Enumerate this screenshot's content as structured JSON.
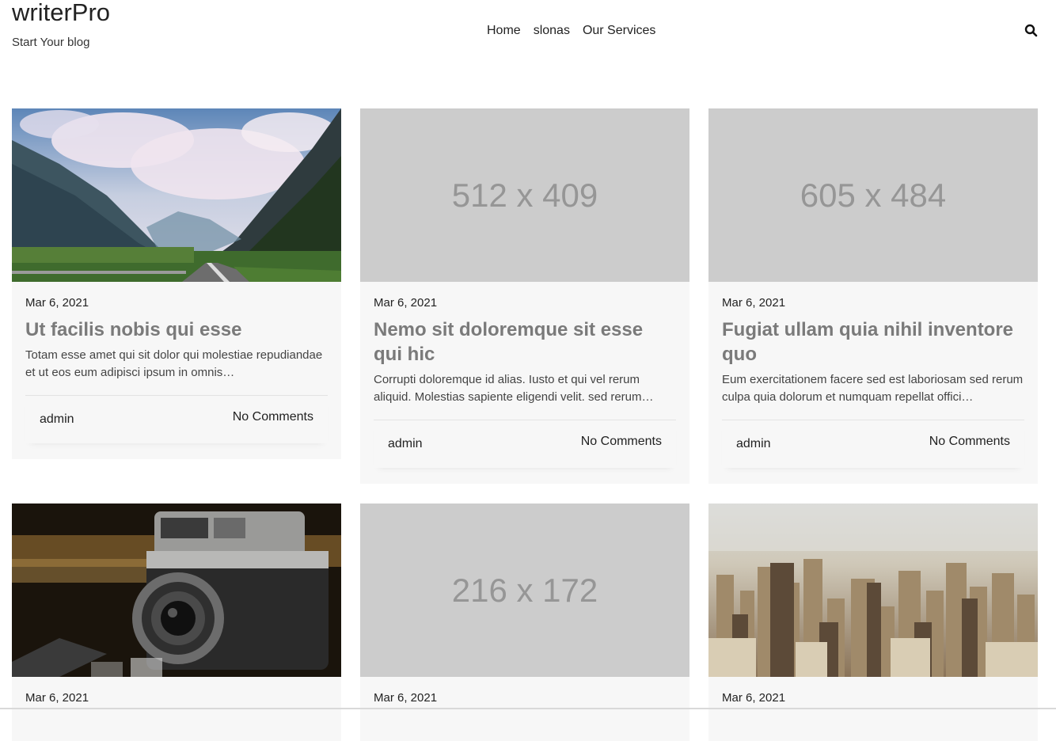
{
  "site": {
    "title": "writerPro",
    "tagline": "Start Your blog"
  },
  "nav": {
    "items": [
      {
        "label": "Home"
      },
      {
        "label": "slonas"
      },
      {
        "label": "Our Services"
      }
    ],
    "search_icon": "search-icon"
  },
  "posts": [
    {
      "image_type": "photo-mountain-road",
      "date": "Mar 6, 2021",
      "title": "Ut facilis nobis qui esse",
      "excerpt": "Totam esse amet qui sit dolor qui molestiae repudiandae et ut eos eum adipisci ipsum in omnis…",
      "author": "admin",
      "comments": "No Comments"
    },
    {
      "image_type": "placeholder",
      "placeholder_text": "512 x 409",
      "date": "Mar 6, 2021",
      "title": "Nemo sit doloremque sit esse qui hic",
      "excerpt": "Corrupti doloremque id alias. Iusto et qui vel rerum aliquid. Molestias sapiente eligendi velit. sed rerum…",
      "author": "admin",
      "comments": "No Comments"
    },
    {
      "image_type": "placeholder",
      "placeholder_text": "605 x 484",
      "date": "Mar 6, 2021",
      "title": "Fugiat ullam quia nihil inventore quo",
      "excerpt": "Eum exercitationem facere sed est laboriosam sed rerum culpa quia dolorum et numquam repellat offici…",
      "author": "admin",
      "comments": "No Comments"
    },
    {
      "image_type": "photo-camera",
      "date": "Mar 6, 2021"
    },
    {
      "image_type": "placeholder",
      "placeholder_text": "216 x 172",
      "date": "Mar 6, 2021"
    },
    {
      "image_type": "photo-city",
      "date": "Mar 6, 2021"
    }
  ],
  "colors": {
    "card_bg": "#f7f7f7",
    "placeholder_bg": "#cccccc",
    "placeholder_text": "#969696",
    "title_color": "#7a7a7a"
  }
}
